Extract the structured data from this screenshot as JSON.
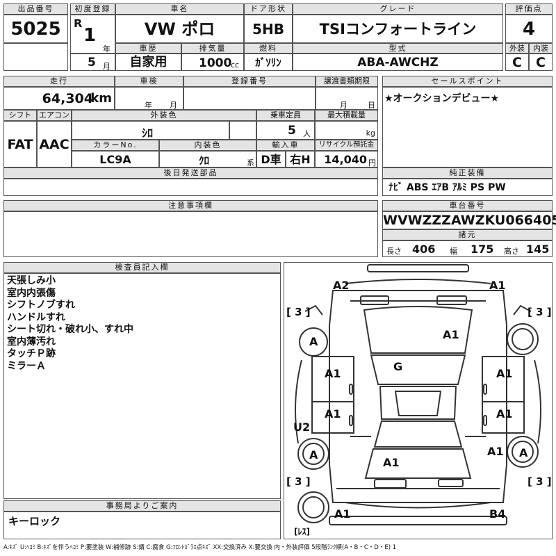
{
  "header": {
    "lot_label": "出品番号",
    "lot_value": "5025",
    "first_reg_label": "初度登録",
    "era": "R",
    "year_value": "1",
    "year_unit": "年",
    "month_value": "5",
    "month_unit": "月",
    "car_name_label": "車名",
    "car_name_value": "VW ポロ",
    "door_label": "ドア形状",
    "door_value": "5HB",
    "grade_label": "グレード",
    "grade_value": "TSIコンフォートライン",
    "score_label": "評価点",
    "score_value": "4",
    "history_label": "車歴",
    "history_value": "自家用",
    "displacement_label": "排気量",
    "displacement_value": "1000",
    "displacement_unit": "cc",
    "fuel_label": "燃料",
    "fuel_value": "ｶﾞｿﾘﾝ",
    "model_label": "型式",
    "model_value": "ABA-AWCHZ",
    "exterior_label": "外装",
    "exterior_value": "C",
    "interior_label": "内装",
    "interior_value": "C"
  },
  "row2": {
    "mileage_label": "走行",
    "mileage_value": "64,304",
    "mileage_unit": "km",
    "inspection_label": "車検",
    "insp_year_unit": "年",
    "insp_month_unit": "月",
    "reg_no_label": "登録番号",
    "transfer_label": "譲渡書類期限",
    "transfer_month_unit": "月",
    "transfer_day_unit": "日",
    "sales_point_label": "セールスポイント",
    "sales_point_value": "★オークションデビュー★"
  },
  "row3": {
    "shift_label": "シフト",
    "shift_value": "FAT",
    "ac_label": "エアコン",
    "ac_value": "AAC",
    "ext_color_label": "外装色",
    "ext_color_value": "ｼﾛ",
    "capacity_label": "乗車定員",
    "capacity_value": "5",
    "capacity_unit": "人",
    "max_load_label": "最大積載量",
    "max_load_unit": "kg",
    "color_no_label": "カラーNo.",
    "color_no_value": "LC9A",
    "int_color_label": "内装色",
    "int_color_value": "ｸﾛ",
    "int_color_unit": "系",
    "import_label": "輸入車",
    "import_value1": "D車",
    "import_value2": "右H",
    "recycle_label": "リサイクル預託金",
    "recycle_value": "14,040",
    "recycle_unit": "円"
  },
  "later_parts_label": "後日発送部品",
  "equipment": {
    "label": "純正装備",
    "value": "ﾅﾋﾞ ABS ｴｱB ｱﾙﾐ PS PW"
  },
  "notes_label": "注意事項欄",
  "chassis": {
    "label": "車台番号",
    "value": "WVWZZZAWZKU066405",
    "spec_label": "諸元",
    "length_label": "長さ",
    "length_value": "406",
    "width_label": "幅",
    "width_value": "175",
    "height_label": "高さ",
    "height_value": "145"
  },
  "inspector": {
    "label": "検査員記入欄",
    "lines": [
      "天張しみ小",
      "室内内張傷",
      "シフトノブすれ",
      "ハンドルすれ",
      "シート切れ・破れ小、すれ中",
      "室内薄汚れ",
      "タッチＰ跡",
      "ミラーＡ"
    ]
  },
  "office": {
    "label": "事務局よりご案内",
    "value": "キーロック"
  },
  "diagram": {
    "marks": {
      "front_left": "A2",
      "front_right": "A1",
      "bracket_top_left": "[ 3 ]",
      "bracket_top_right": "[ 3 ]",
      "tire_front_left": "A",
      "tire_front_right": "",
      "hood": "A1",
      "roof": "G",
      "door_fl": "A1",
      "door_fr": "A1",
      "door_rl": "A1",
      "door_rr": "A1",
      "side_left": "U2",
      "tire_rear_left": "A",
      "tire_rear_right": "A",
      "rear_right_mark": "A1",
      "trunk": "A1",
      "bracket_bottom_left": "[ 3 ]",
      "bracket_bottom_right": "[ 3 ]",
      "bumper_left": "A1",
      "bumper_right": "B4",
      "spare": "[ﾚｽ]"
    }
  },
  "legend": "A:ｷｽﾞ U:ﾍｺﾐ B:ｷｽﾞを伴うﾍｺﾐ P:要塗装 W:補修跡 S:錆 C:腐食 G:ﾌﾛﾝﾄｶﾞﾗｽ点ｷｽﾞ XX:交換済み X:要交換 内・外装評価 5段階ﾗﾝｸ順(A・B・C・D・E) 1"
}
